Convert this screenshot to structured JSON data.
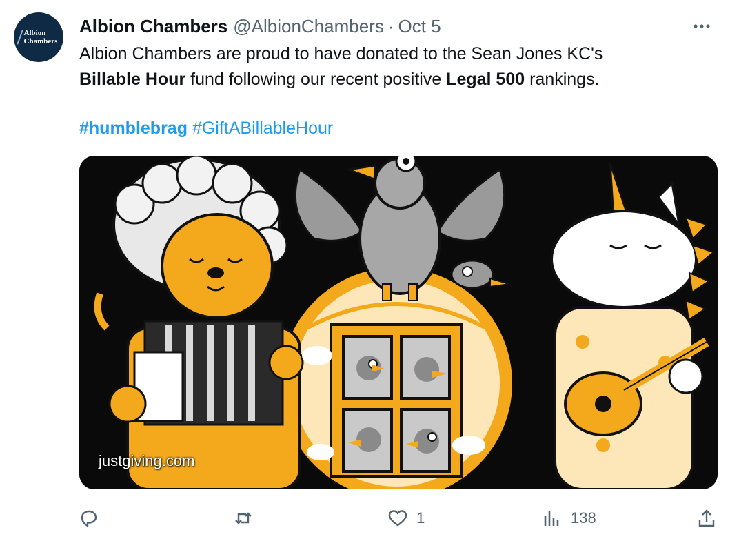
{
  "tweet": {
    "author_name": "Albion Chambers",
    "handle": "@AlbionChambers",
    "separator": "·",
    "date": "Oct 5",
    "avatar_text": [
      "Albion",
      "Chambers"
    ],
    "more_icon": "more-horizontal-icon",
    "text": {
      "part1": "Albion Chambers are proud to have donated to the Sean Jones KC's",
      "bold1": "Billable Hour",
      "part2": " fund following our recent positive ",
      "bold2": "Legal 500",
      "part3": " rankings."
    },
    "hashtags": [
      "#humblebrag",
      "#GiftABillableHour"
    ],
    "media": {
      "watermark": "justgiving.com",
      "colors": {
        "background": "#0a0a0a",
        "orange": "#f4a91d",
        "cream": "#fde7b8",
        "grey": "#a7a7a7"
      }
    },
    "actions": {
      "reply": {
        "icon": "reply-icon",
        "count": ""
      },
      "retweet": {
        "icon": "retweet-icon",
        "count": ""
      },
      "like": {
        "icon": "heart-icon",
        "count": "1"
      },
      "views": {
        "icon": "analytics-icon",
        "count": "138"
      },
      "share": {
        "icon": "share-icon",
        "count": ""
      }
    },
    "colors": {
      "link": "#1d9bf0",
      "secondary": "#536471",
      "text": "#0f1419"
    }
  }
}
